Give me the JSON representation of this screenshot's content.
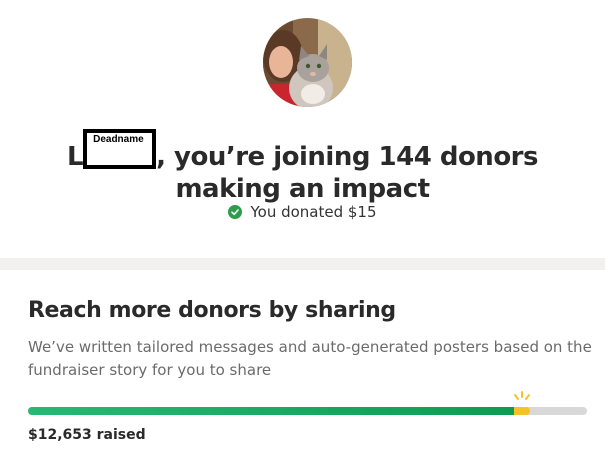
{
  "header": {
    "headline_prefix": "L",
    "redaction_label": "Deadname",
    "headline_line1_rest": ", you’re joining 144 donors",
    "headline_line2": "making an impact",
    "donated_text": "You donated $15",
    "icons": {
      "avatar": "profile-photo",
      "check": "check-circle-icon"
    },
    "colors": {
      "check": "#2e9c4f"
    }
  },
  "share": {
    "title": "Reach more donors by sharing",
    "description": "We’ve written tailored messages and auto-generated posters based on the fundraiser story for you to share",
    "progress_fraction": 0.87,
    "raised_text": "$12,653 raised",
    "colors": {
      "fill_start": "#2bb673",
      "fill_end": "#129a52",
      "tip": "#f5c22a",
      "track": "#d8d8d8"
    }
  }
}
